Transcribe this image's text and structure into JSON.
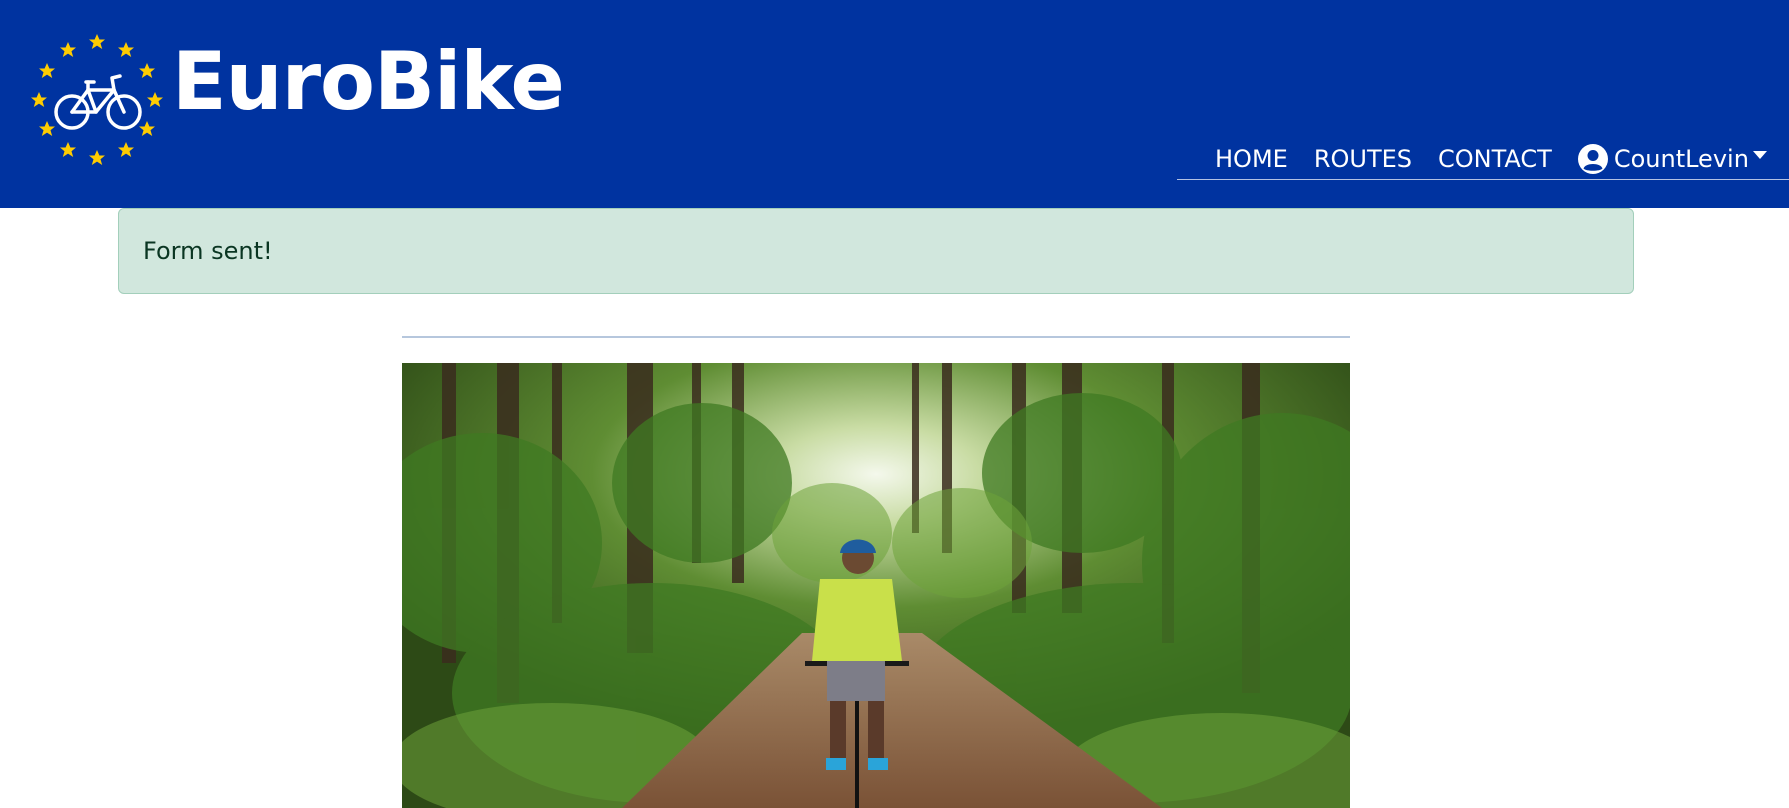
{
  "brand": {
    "name": "EuroBike",
    "logo_icon": "bicycle-in-eu-stars",
    "star_color": "#ffcc00"
  },
  "nav": {
    "items": [
      {
        "label": "HOME"
      },
      {
        "label": "ROUTES"
      },
      {
        "label": "CONTACT"
      }
    ],
    "user": {
      "name": "CountLevin",
      "icon": "user-circle-icon"
    }
  },
  "alert": {
    "message": "Form sent!",
    "type": "success"
  },
  "main": {
    "heading": "",
    "hero_image": "cyclist riding on forest trail"
  },
  "colors": {
    "header_bg": "#0033a0",
    "alert_bg": "#d1e7dd",
    "alert_text": "#0a3622"
  }
}
